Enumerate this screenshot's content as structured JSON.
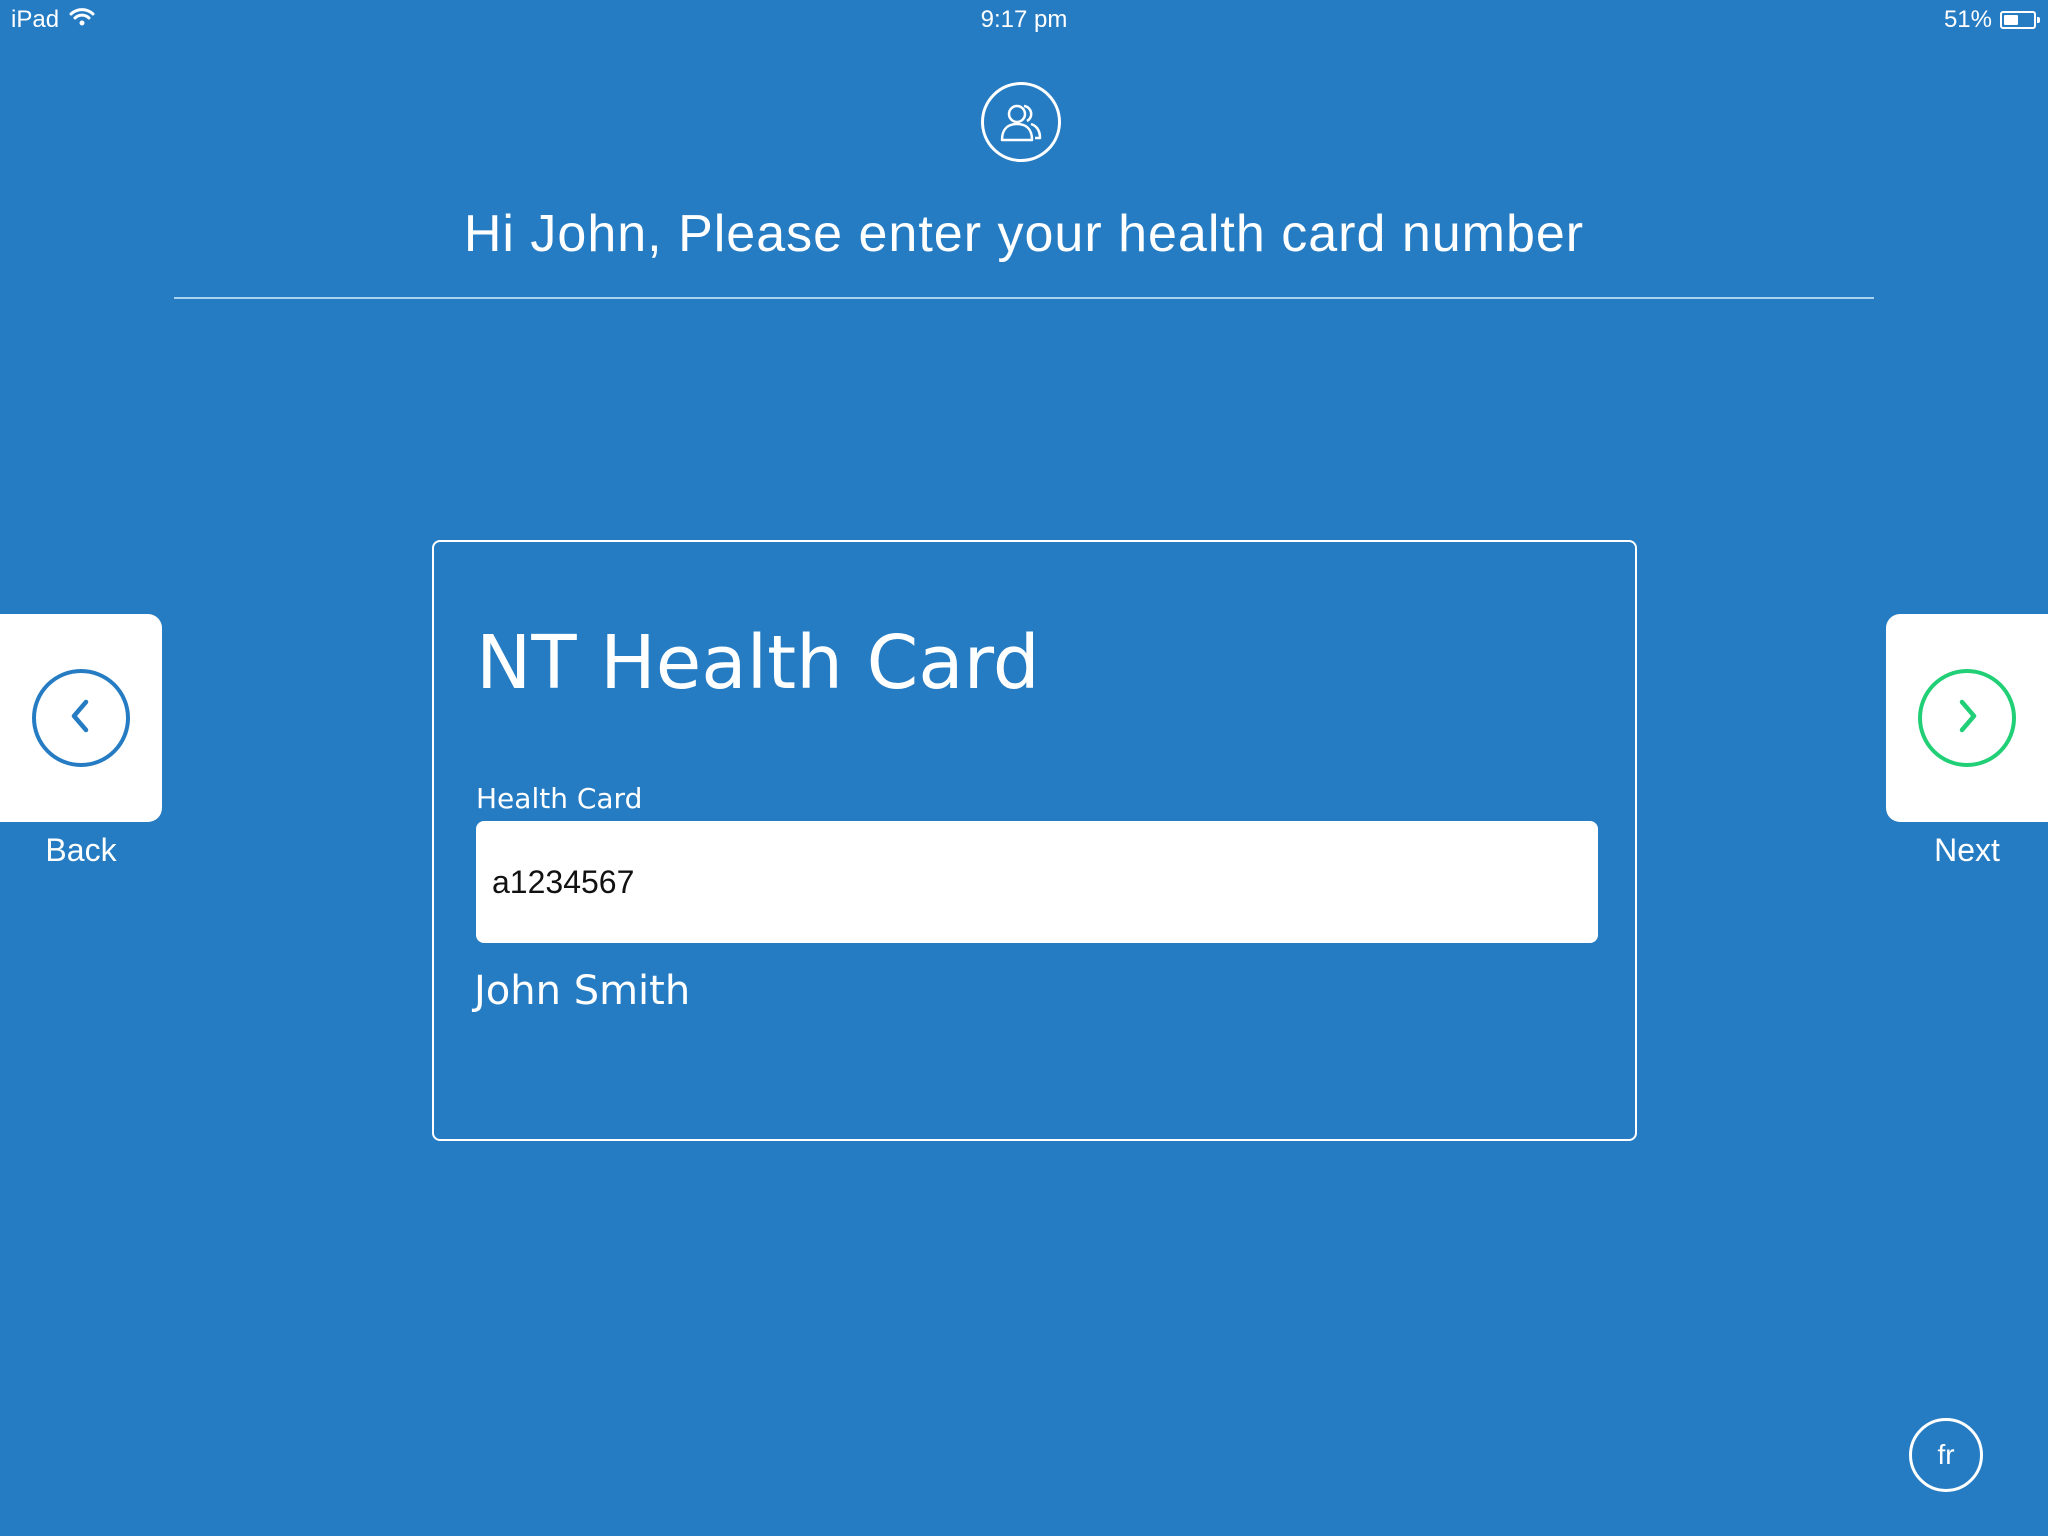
{
  "status_bar": {
    "device": "iPad",
    "time": "9:17 pm",
    "battery": "51%",
    "battery_level": 0.51,
    "icons": [
      "wifi-icon",
      "battery-icon"
    ]
  },
  "header": {
    "icon": "users-icon",
    "title": "Hi John, Please enter your health card number"
  },
  "card": {
    "title": "NT Health Card",
    "field_label": "Health Card",
    "field_value": "a1234567",
    "patient_name": "John Smith"
  },
  "nav": {
    "back_label": "Back",
    "back_icon": "chevron-left-icon",
    "next_label": "Next",
    "next_icon": "chevron-right-icon"
  },
  "language": {
    "label": "fr"
  },
  "colors": {
    "background": "#267cc3",
    "next_accent": "#21cf76",
    "text": "#ffffff"
  }
}
